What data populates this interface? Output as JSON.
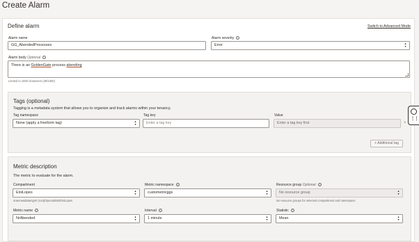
{
  "page": {
    "title": "Create Alarm"
  },
  "define": {
    "title": "Define alarm",
    "advanced_link": "Switch to Advanced Mode",
    "alarm_name": {
      "label": "Alarm name",
      "value": "GG_AbendedProcesses"
    },
    "alarm_severity": {
      "label": "Alarm severity",
      "value": "Error"
    },
    "alarm_body": {
      "label": "Alarm body",
      "optional": "Optional",
      "value_prefix": "There is an ",
      "value_word1": "GoldenGate",
      "value_mid": " process ",
      "value_word2": "abending",
      "hint": "Limited to 1000 characters (39/1000)"
    }
  },
  "tags": {
    "title": "Tags (optional)",
    "description": "Tagging is a metadata system that allows you to organize and track alarms within your tenancy.",
    "namespace": {
      "label": "Tag namespace",
      "value": "None (apply a freeform tag)"
    },
    "key": {
      "label": "Tag key",
      "placeholder": "Enter a tag key"
    },
    "value": {
      "label": "Value",
      "placeholder": "Enter a tag key first"
    },
    "remove_symbol": "×",
    "additional_button": "+ Additional tag"
  },
  "metric": {
    "title": "Metric description",
    "description": "The metric to evaluate for the alarm.",
    "compartment": {
      "label": "Compartment",
      "value": "EloiLopes",
      "hint": "oraemeadatamgmt (root)/Specialists/EloiLopes"
    },
    "namespace": {
      "label": "Metric namespace",
      "value": "custometricggs"
    },
    "resource_group": {
      "label": "Resource group",
      "optional": "Optional",
      "value": "No resource group",
      "hint": "No resource groups for selected compartment and namespace"
    },
    "metric_name": {
      "label": "Metric name",
      "value": "NrAbended"
    },
    "interval": {
      "label": "Interval",
      "value": "1 minute"
    },
    "statistic": {
      "label": "Statistic",
      "value": "Mean"
    }
  },
  "icons": {
    "info": "info-icon",
    "select": "up-down-chevron-icon",
    "help": "help-lifebuoy-icon",
    "grid": "grid-dots-icon"
  },
  "colors": {
    "accent_underline": "#b5552b",
    "panel_bg": "#f3f2f0",
    "page_bg": "#f5f4f2"
  }
}
